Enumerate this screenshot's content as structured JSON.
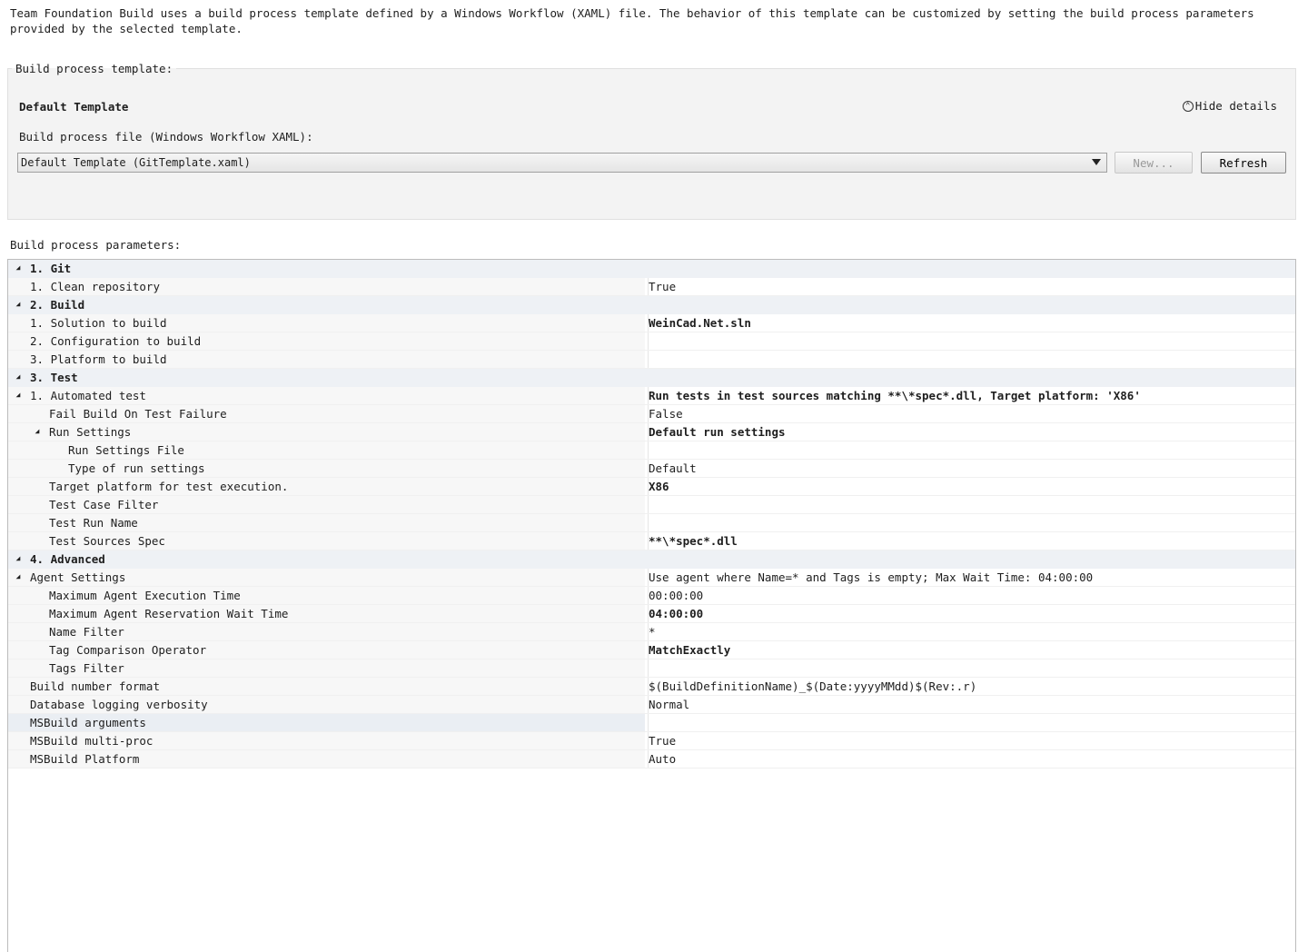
{
  "intro": "Team Foundation Build uses a build process template defined by a Windows Workflow (XAML) file. The behavior of this template can be customized by setting the build process parameters provided by the selected template.",
  "template": {
    "legend": "Build process template:",
    "name": "Default Template",
    "hide_details": "Hide details",
    "file_label": "Build process file (Windows Workflow XAML):",
    "selected_file": "Default Template (GitTemplate.xaml)",
    "new_button": "New...",
    "refresh_button": "Refresh"
  },
  "params_label": "Build process parameters:",
  "rows": [
    {
      "name": "1. Git",
      "value": "",
      "level": 0,
      "category": true,
      "expander": true
    },
    {
      "name": "1. Clean repository",
      "value": "True",
      "level": 1
    },
    {
      "name": "2. Build",
      "value": "",
      "level": 0,
      "category": true,
      "expander": true
    },
    {
      "name": "1. Solution to build",
      "value": "WeinCad.Net.sln",
      "level": 1,
      "bold": true
    },
    {
      "name": "2. Configuration to build",
      "value": "",
      "level": 1
    },
    {
      "name": "3. Platform to build",
      "value": "",
      "level": 1
    },
    {
      "name": "3. Test",
      "value": "",
      "level": 0,
      "category": true,
      "expander": true
    },
    {
      "name": "1. Automated test",
      "value": "Run tests in test sources matching **\\*spec*.dll, Target platform: 'X86'",
      "level": 1,
      "bold": true,
      "expander": true
    },
    {
      "name": "Fail Build On Test Failure",
      "value": "False",
      "level": 2
    },
    {
      "name": "Run Settings",
      "value": "Default run settings",
      "level": 2,
      "bold": true,
      "expander": true
    },
    {
      "name": "Run Settings File",
      "value": "",
      "level": 3
    },
    {
      "name": "Type of run settings",
      "value": "Default",
      "level": 3
    },
    {
      "name": "Target platform for test execution.",
      "value": "X86",
      "level": 2,
      "bold": true
    },
    {
      "name": "Test Case Filter",
      "value": "",
      "level": 2
    },
    {
      "name": "Test Run Name",
      "value": "",
      "level": 2
    },
    {
      "name": "Test Sources Spec",
      "value": "**\\*spec*.dll",
      "level": 2,
      "bold": true
    },
    {
      "name": "4. Advanced",
      "value": "",
      "level": 0,
      "category": true,
      "expander": true
    },
    {
      "name": "Agent Settings",
      "value": "Use agent where Name=* and Tags is empty; Max Wait Time: 04:00:00",
      "level": 1,
      "expander": true
    },
    {
      "name": "Maximum Agent Execution Time",
      "value": "00:00:00",
      "level": 2
    },
    {
      "name": "Maximum Agent Reservation Wait Time",
      "value": "04:00:00",
      "level": 2,
      "bold": true
    },
    {
      "name": "Name Filter",
      "value": "*",
      "level": 2
    },
    {
      "name": "Tag Comparison Operator",
      "value": "MatchExactly",
      "level": 2,
      "bold": true
    },
    {
      "name": "Tags Filter",
      "value": "",
      "level": 2
    },
    {
      "name": "Build number format",
      "value": "$(BuildDefinitionName)_$(Date:yyyyMMdd)$(Rev:.r)",
      "level": 1
    },
    {
      "name": "Database logging verbosity",
      "value": "Normal",
      "level": 1
    },
    {
      "name": "MSBuild arguments",
      "value": "",
      "level": 1,
      "highlight": true
    },
    {
      "name": "MSBuild multi-proc",
      "value": "True",
      "level": 1
    },
    {
      "name": "MSBuild Platform",
      "value": "Auto",
      "level": 1
    }
  ]
}
